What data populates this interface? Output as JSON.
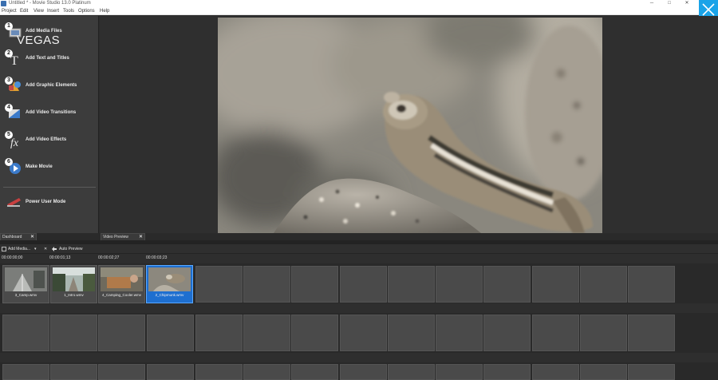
{
  "window": {
    "title": "Untitled * - Movie Studio 13.0 Platinum",
    "minimize_glyph": "─",
    "maximize_glyph": "□",
    "close_glyph": "✕"
  },
  "menu": [
    "Project",
    "Edit",
    "View",
    "Insert",
    "Tools",
    "Options",
    "Help"
  ],
  "overlay_close_icon": "close-icon",
  "wizard": {
    "logo": "VEGAS",
    "steps": [
      {
        "num": "1",
        "label": "Add Media Files",
        "icon": "media-files-icon"
      },
      {
        "num": "2",
        "label": "Add Text and Titles",
        "icon": "text-titles-icon"
      },
      {
        "num": "3",
        "label": "Add Graphic Elements",
        "icon": "graphic-elements-icon"
      },
      {
        "num": "4",
        "label": "Add Video Transitions",
        "icon": "video-transitions-icon"
      },
      {
        "num": "5",
        "label": "Add Video Effects",
        "icon": "video-effects-icon"
      },
      {
        "num": "6",
        "label": "Make Movie",
        "icon": "make-movie-icon"
      },
      {
        "num": "",
        "label": "Power User Mode",
        "icon": "power-user-icon"
      }
    ]
  },
  "panes": {
    "dashboard_tab": "Dashboard",
    "preview_tab": "Video Preview",
    "tab_close": "✕"
  },
  "media_toolbar": {
    "add_media": "Add Media...",
    "dropdown_glyph": "▾",
    "remove_glyph": "✕",
    "auto_preview": "Auto Preview"
  },
  "timeline": {
    "timecodes": [
      "00:00:00;00",
      "00:00:01;13",
      "00:00:02;27",
      "00:00:03;23"
    ],
    "clips": [
      {
        "name": "3_Camp.wmv",
        "selected": false
      },
      {
        "name": "1_Intro.wmv",
        "selected": false
      },
      {
        "name": "4_Camping_Cooler.wmv",
        "selected": false
      },
      {
        "name": "2_Chipmunk.wmv",
        "selected": true
      }
    ]
  },
  "colors": {
    "accent": "#1aa3e8",
    "selection": "#1e6fd0",
    "panel": "#3c3c3c",
    "cell": "#4a4a4a"
  }
}
